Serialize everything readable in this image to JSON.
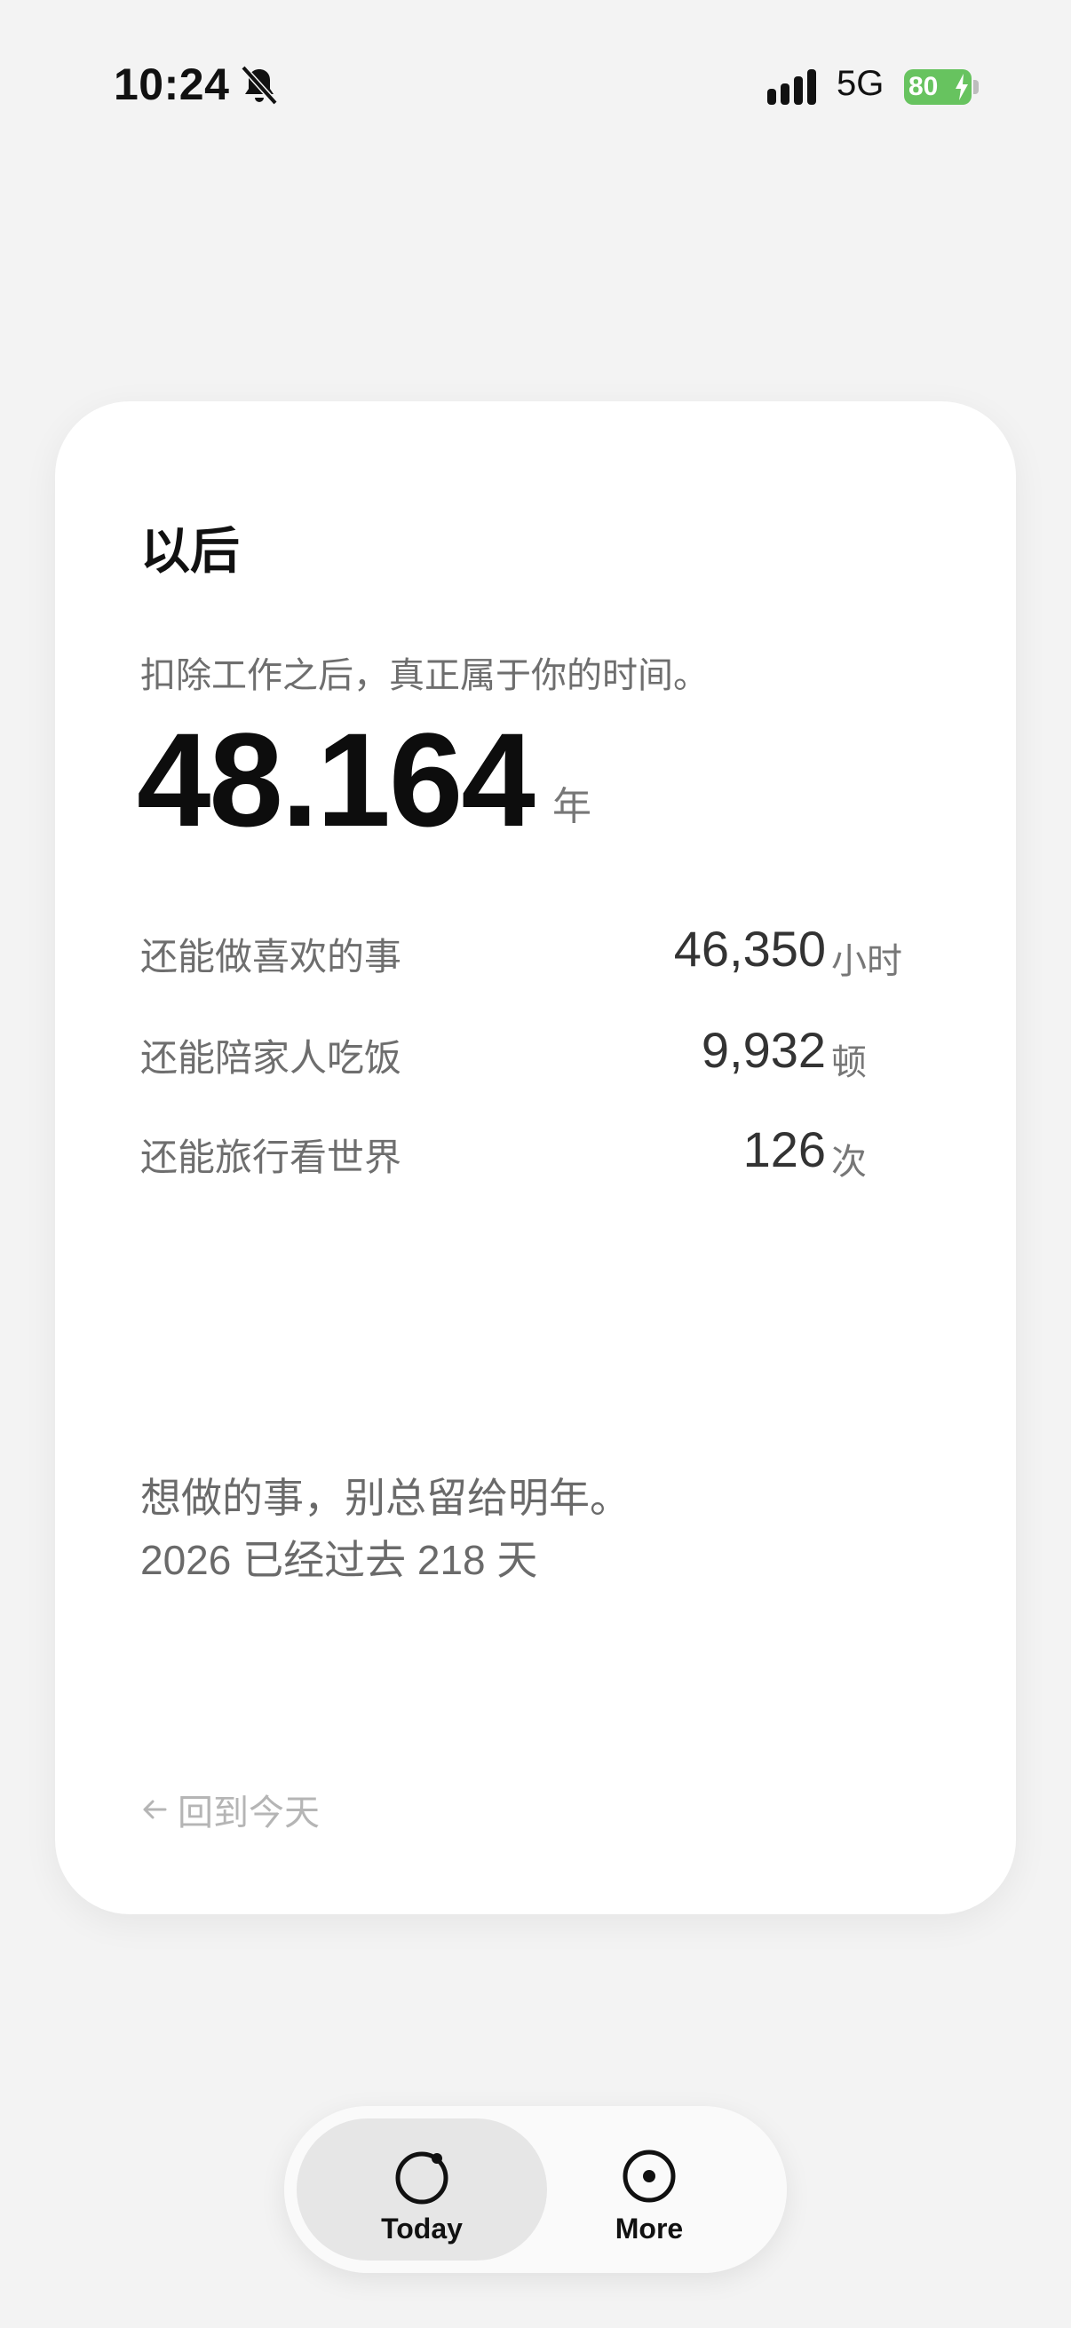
{
  "status": {
    "time": "10:24",
    "network": "5G",
    "battery": "80"
  },
  "card": {
    "title": "以后",
    "subtitle": "扣除工作之后，真正属于你的时间。",
    "big_value": "48.164",
    "big_unit": "年",
    "stats": [
      {
        "label": "还能做喜欢的事",
        "value": "46,350",
        "unit": "小时"
      },
      {
        "label": "还能陪家人吃饭",
        "value": "9,932",
        "unit": "顿"
      },
      {
        "label": "还能旅行看世界",
        "value": "126",
        "unit": "次"
      }
    ],
    "quote_line1": "想做的事，别总留给明年。",
    "quote_line2": "2026 已经过去 218 天",
    "back_label": "回到今天"
  },
  "tabbar": {
    "tabs": [
      {
        "label": "Today",
        "icon": "today-circle-icon",
        "active": true
      },
      {
        "label": "More",
        "icon": "more-dot-circle-icon",
        "active": false
      }
    ]
  }
}
